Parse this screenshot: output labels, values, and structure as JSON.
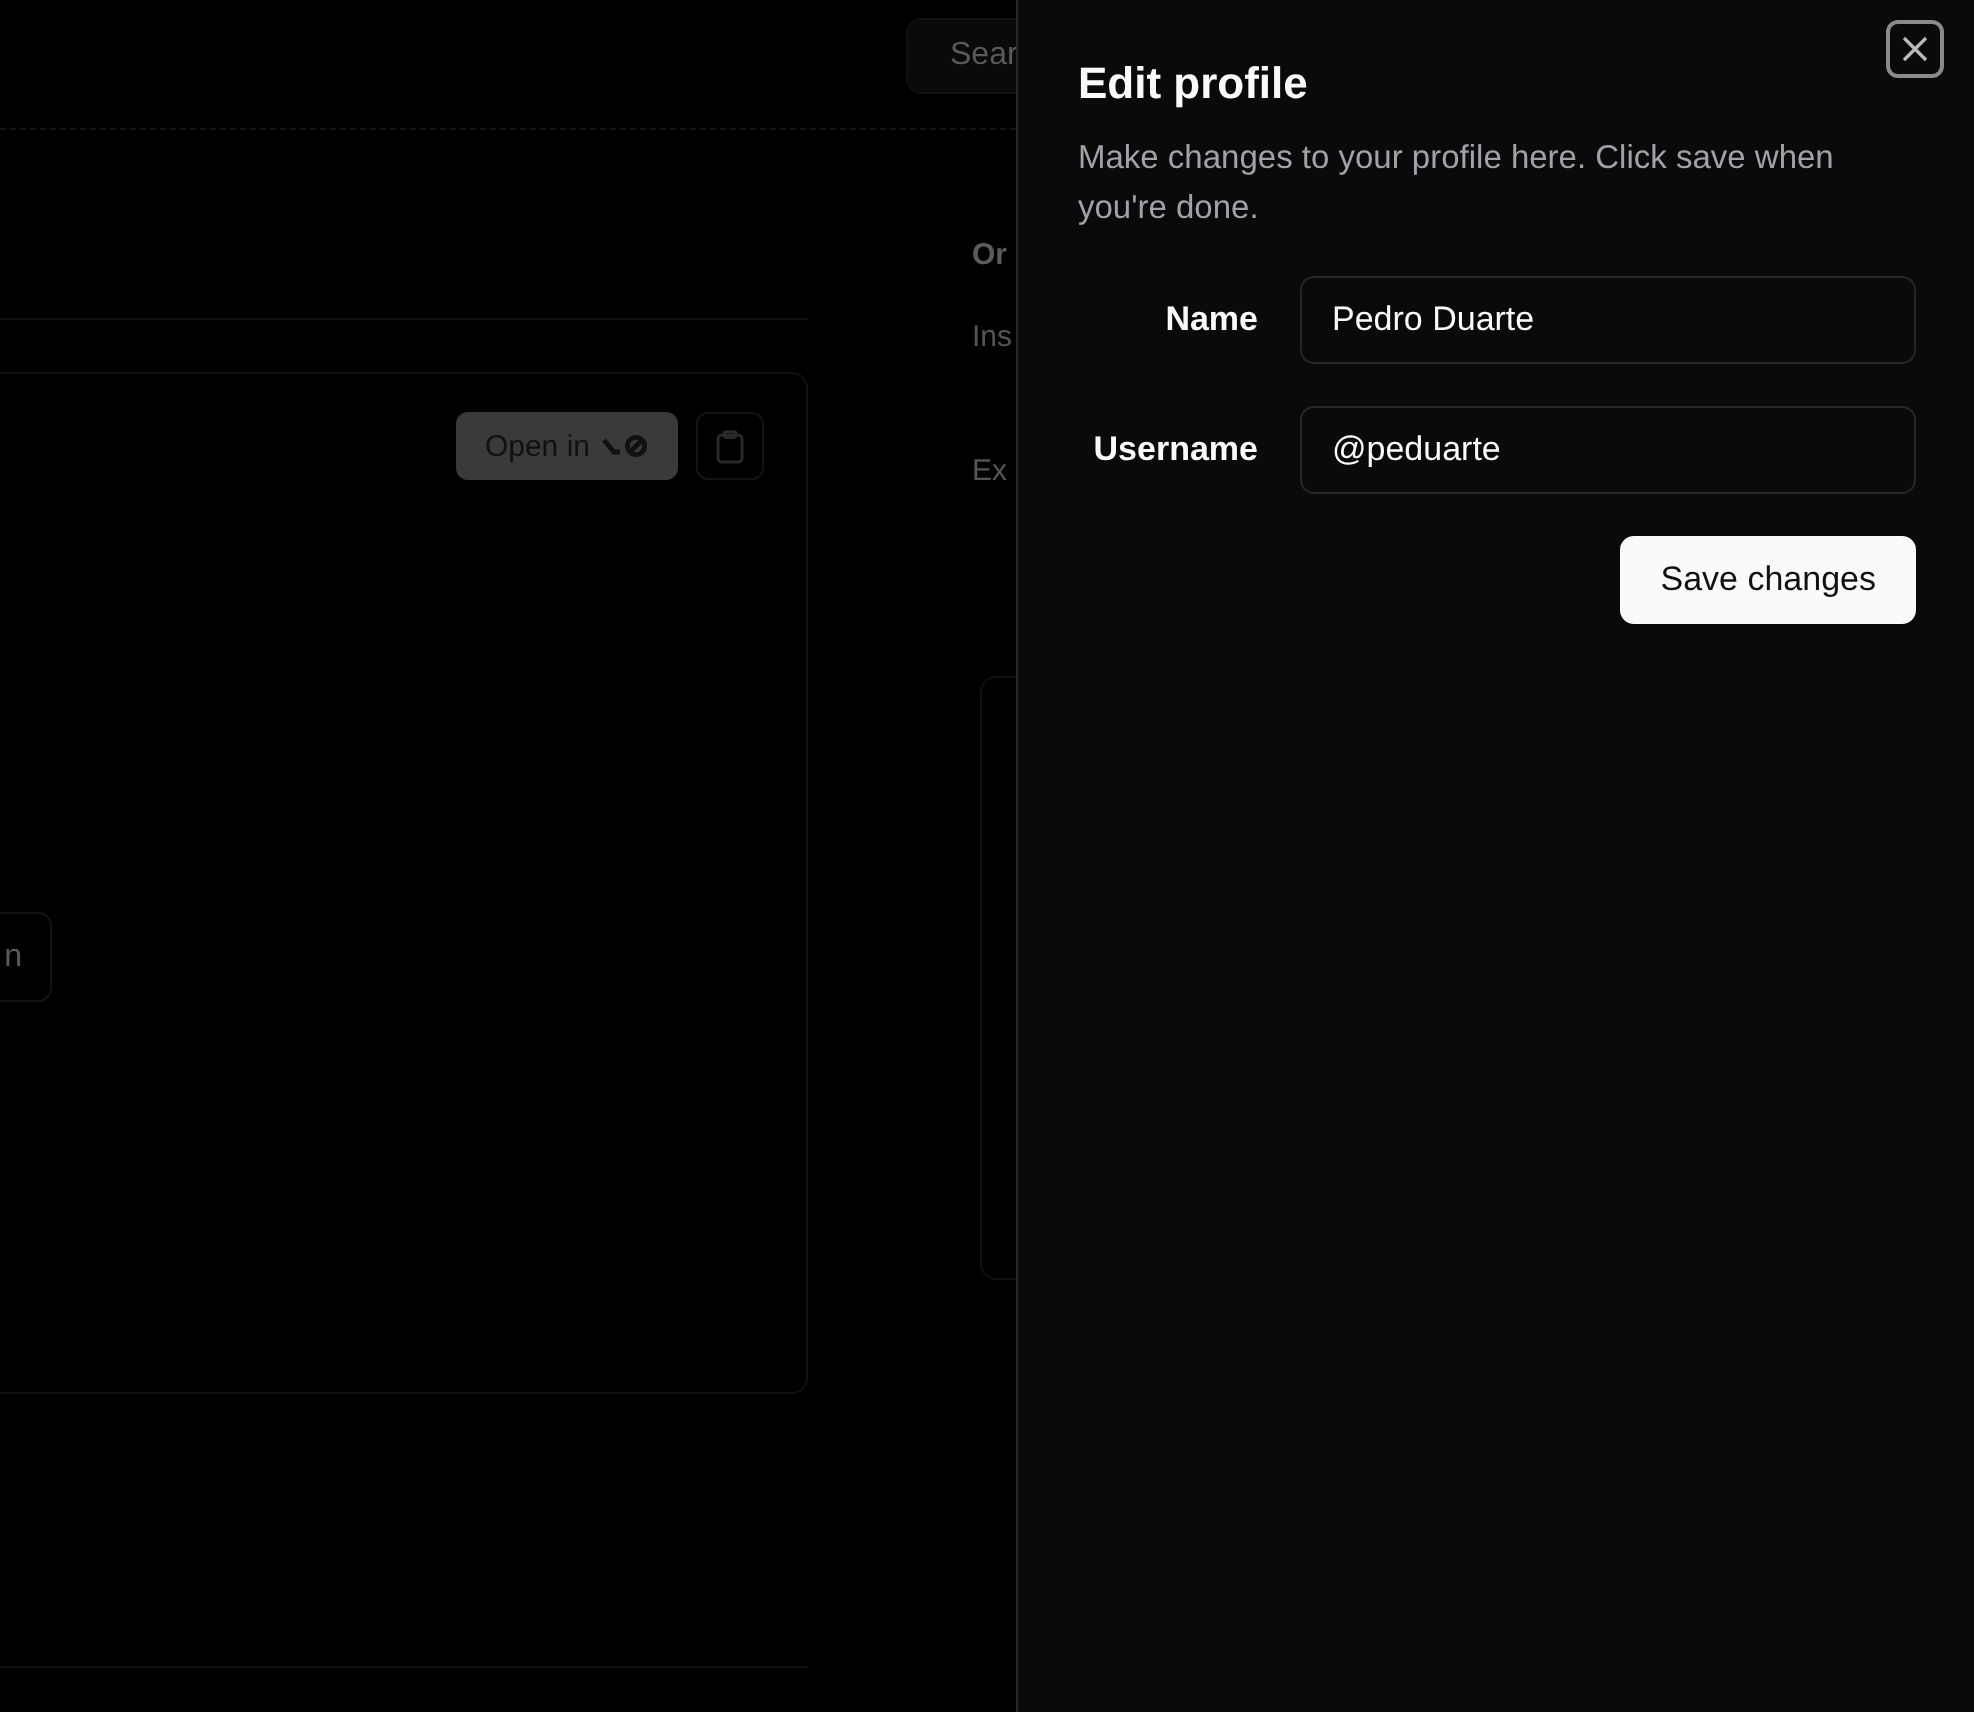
{
  "background": {
    "search": {
      "placeholder": "Sear"
    },
    "sections": [
      {
        "kind": "heading",
        "text": "Or"
      },
      {
        "kind": "link",
        "text": "Ins"
      },
      {
        "kind": "link",
        "text": "Ex"
      }
    ],
    "preview": {
      "open_button": "Open in",
      "partial_button": "n"
    }
  },
  "sheet": {
    "title": "Edit profile",
    "description": "Make changes to your profile here. Click save when you're done.",
    "fields": [
      {
        "label": "Name",
        "value": "Pedro Duarte"
      },
      {
        "label": "Username",
        "value": "@peduarte"
      }
    ],
    "submit": "Save changes"
  }
}
